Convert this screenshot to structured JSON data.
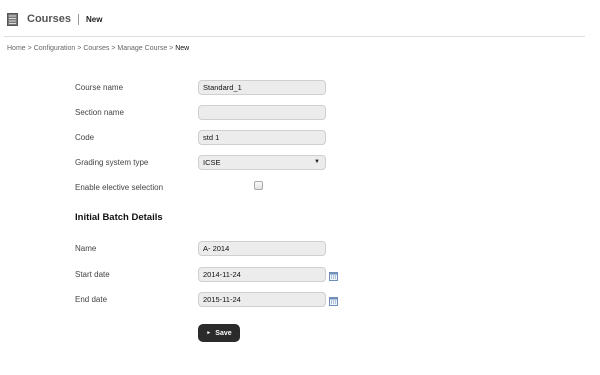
{
  "header": {
    "title": "Courses",
    "subtitle": "New",
    "icon": "document-list-icon"
  },
  "breadcrumb": {
    "items": [
      "Home",
      "Configuration",
      "Courses",
      "Manage Course"
    ],
    "separator": ">",
    "current": "New"
  },
  "form": {
    "course_name": {
      "label": "Course name",
      "value": "Standard_1"
    },
    "section_name": {
      "label": "Section name",
      "value": ""
    },
    "code": {
      "label": "Code",
      "value": "std 1"
    },
    "grading_system": {
      "label": "Grading system type",
      "selected": "ICSE"
    },
    "elective": {
      "label": "Enable elective selection",
      "checked": false
    }
  },
  "batch": {
    "heading": "Initial Batch Details",
    "name": {
      "label": "Name",
      "value": "A- 2014"
    },
    "start_date": {
      "label": "Start date",
      "value": "2014-11-24",
      "icon": "calendar-icon"
    },
    "end_date": {
      "label": "End date",
      "value": "2015-11-24",
      "icon": "calendar-icon"
    }
  },
  "actions": {
    "save_label": "Save",
    "save_icon": "play-arrow-icon"
  }
}
